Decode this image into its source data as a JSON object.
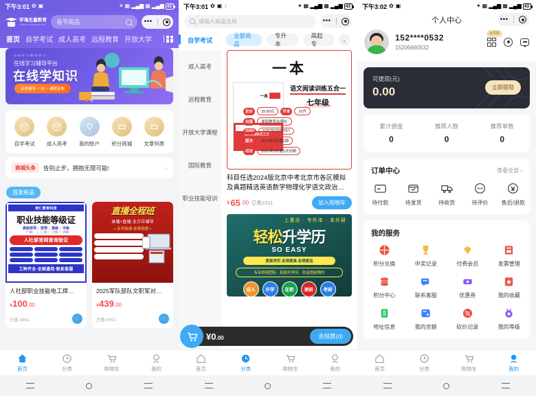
{
  "phone1": {
    "status": {
      "time": "下午3:01",
      "battery": "43"
    },
    "brand": {
      "name": "学海无量教育",
      "sub": "XUEHAI WULIANG EDU"
    },
    "search": {
      "placeholder": "春节商品",
      "icon": "search-icon"
    },
    "nav": [
      {
        "label": "首页",
        "active": true
      },
      {
        "label": "自学考试",
        "active": false
      },
      {
        "label": "成人高考",
        "active": false
      },
      {
        "label": "远程教育",
        "active": false
      },
      {
        "label": "开放大学",
        "active": false
      }
    ],
    "banner": {
      "eyebrow": "在/线/学/习/辅/导/学/习",
      "subtitle": "在线学习辅导平台",
      "title": "在线学知识",
      "pill": "名师辅导·一对一·课程定制",
      "dots": 2,
      "active_dot": 1
    },
    "quick": [
      {
        "label": "自学考试",
        "icon": "coin-gold-icon",
        "color": "#e8c887"
      },
      {
        "label": "成人高考",
        "icon": "coin-gold-icon",
        "color": "#e8c887"
      },
      {
        "label": "我的账户",
        "icon": "diamond-icon",
        "color": "#b9cfe8"
      },
      {
        "label": "积分商城",
        "icon": "crown-icon",
        "color": "#e8c887"
      },
      {
        "label": "文章列表",
        "icon": "crown-icon",
        "color": "#e8c887"
      }
    ],
    "notice": {
      "tag": "商城头条",
      "text": "告别止步，拥抱无限可能!",
      "arrow": "chevron-right-icon"
    },
    "new_tag": "首发新品",
    "products": [
      {
        "name": "人社部职业技能电工焊…",
        "price_symbol": "¥",
        "price_int": "100",
        "price_dec": ".00",
        "sold": "已售 8461",
        "poster": {
          "header": "培仁教育科技",
          "title": "职业技能等级证",
          "cols": [
            {
              "t": "高级技师",
              "s": "(一级)"
            },
            {
              "t": "技师",
              "s": "(二级)"
            },
            {
              "t": "高级",
              "s": "(三级)"
            },
            {
              "t": "中级",
              "s": "(四级)"
            }
          ],
          "redband": "人社部官网查询验证",
          "footer": "工种齐全·全国通用·联系客服"
        }
      },
      {
        "name": "2025军队部队文职军对…",
        "price_symbol": "¥",
        "price_int": "439",
        "price_dec": ".00",
        "sold": "已售 6451",
        "poster": {
          "title": "直播全程班",
          "sub1": "录播+直播·全方位辅导",
          "sub2": "⇢ 名师授课·逐章梳理 ⇠",
          "bars": 4
        }
      }
    ],
    "tabbar": [
      {
        "label": "首页",
        "icon": "home-icon",
        "active": true
      },
      {
        "label": "分类",
        "icon": "category-icon",
        "active": false
      },
      {
        "label": "购物车",
        "icon": "cart-icon",
        "active": false
      },
      {
        "label": "我的",
        "icon": "user-icon",
        "active": false
      }
    ]
  },
  "phone2": {
    "status": {
      "time": "下午3:01",
      "battery": "43"
    },
    "search": {
      "placeholder": "请输入商品名称",
      "icon": "search-icon"
    },
    "active_category": "自学考试",
    "filters": [
      {
        "label": "全部商品",
        "active": true
      },
      {
        "label": "专升本",
        "active": false
      },
      {
        "label": "高起专",
        "active": false
      }
    ],
    "filter_expand_icon": "chevron-down-icon",
    "sidebar": [
      {
        "label": "成人高考"
      },
      {
        "label": "远程教育"
      },
      {
        "label": "开放大学课程"
      },
      {
        "label": "国际教育"
      },
      {
        "label": "职业技能培训"
      }
    ],
    "book": {
      "brand": "一本",
      "series": "语文阅读训练五合一",
      "grade": "七年级",
      "cover_title": "语文阅读训练五合一",
      "specs": [
        {
          "k": "定价",
          "v": "39.80元"
        },
        {
          "k": "开本",
          "v": "16开"
        },
        {
          "k": "出版",
          "v": "湖南教育出版社"
        },
        {
          "k": "ISBN",
          "v": "9787553967257"
        },
        {
          "k": "版次",
          "v": "2019年4月第1版"
        },
        {
          "k": "印次",
          "v": "2021年3月第3次印刷"
        }
      ],
      "title": "科目任选2024版北京中考北京市各区模拟及真题精选英语数学物理化学语文政治…",
      "price_symbol": "¥",
      "price_int": "65",
      "price_dec": ".00",
      "sold": "已售2311",
      "add_button": "加入购物车"
    },
    "ad": {
      "top": "上重点 · 专升本 · 本升研",
      "title_a": "轻松",
      "title_b": "升学历",
      "soeasy": "SO EASY",
      "band1": "更高学历 走得更高 走得更远",
      "band2": "专业师资团队 · 轻松升学历 · 欢迎提前预约",
      "pills": [
        {
          "label": "成人",
          "color": "#f0932b"
        },
        {
          "label": "升学",
          "color": "#2b7de9"
        },
        {
          "label": "在职",
          "color": "#16a34a"
        },
        {
          "label": "读研",
          "color": "#dc2626"
        },
        {
          "label": "考研",
          "color": "#2b7de9"
        }
      ]
    },
    "cartbar": {
      "icon": "cart-icon",
      "symbol": "¥",
      "amount_int": "0",
      "amount_dec": ".00",
      "checkout": "去结算(0)"
    },
    "tabbar": [
      {
        "label": "首页",
        "icon": "home-icon",
        "active": false
      },
      {
        "label": "分类",
        "icon": "category-icon",
        "active": true
      },
      {
        "label": "购物车",
        "icon": "cart-icon",
        "active": false
      },
      {
        "label": "我的",
        "icon": "user-icon",
        "active": false
      }
    ]
  },
  "phone3": {
    "status": {
      "time": "下午3:02",
      "battery": "43"
    },
    "title": "个人中心",
    "user": {
      "masked_phone": "152****0532",
      "phone": "15206660532",
      "avatar": "avatar"
    },
    "vip_badge": "会员码",
    "header_icons": [
      {
        "name": "qr-code-icon"
      },
      {
        "name": "settings-icon"
      },
      {
        "name": "message-icon"
      }
    ],
    "wallet": {
      "label": "可提现(元)",
      "value": "0.00",
      "button": "立即提现"
    },
    "stats": [
      {
        "k": "累计佣金",
        "v": "0"
      },
      {
        "k": "推荐人数",
        "v": "0"
      },
      {
        "k": "推荐单数",
        "v": "0"
      }
    ],
    "orders": {
      "title": "订单中心",
      "view_all": "查看全部 ›",
      "items": [
        {
          "label": "待付款",
          "icon": "card-icon"
        },
        {
          "label": "待发货",
          "icon": "box-check-icon"
        },
        {
          "label": "待收货",
          "icon": "truck-icon"
        },
        {
          "label": "待评价",
          "icon": "comment-icon"
        },
        {
          "label": "售后/退款",
          "icon": "refund-icon"
        }
      ]
    },
    "services": {
      "title": "我的服务",
      "items": [
        {
          "label": "积分兑换",
          "icon": "gift-ball-icon",
          "color": "#e8574a"
        },
        {
          "label": "中奖记录",
          "icon": "trophy-icon",
          "color": "#f5b942"
        },
        {
          "label": "付费会员",
          "icon": "diamond-icon",
          "color": "#f5b942"
        },
        {
          "label": "发票管理",
          "icon": "invoice-icon",
          "color": "#e8574a"
        },
        {
          "label": "积分中心",
          "icon": "coins-icon",
          "color": "#e8574a"
        },
        {
          "label": "联系客服",
          "icon": "chat-icon",
          "color": "#3b82f6"
        },
        {
          "label": "优惠券",
          "icon": "coupon-icon",
          "color": "#8b5cf6"
        },
        {
          "label": "我的收藏",
          "icon": "star-icon",
          "color": "#e8574a"
        },
        {
          "label": "地址信息",
          "icon": "address-icon",
          "color": "#22c55e"
        },
        {
          "label": "我的余额",
          "icon": "wallet-icon",
          "color": "#3b82f6"
        },
        {
          "label": "砍价记录",
          "icon": "discount-icon",
          "color": "#e8574a"
        },
        {
          "label": "我的等级",
          "icon": "medal-icon",
          "color": "#8b5cf6"
        }
      ]
    },
    "tabbar": [
      {
        "label": "首页",
        "icon": "home-icon",
        "active": false
      },
      {
        "label": "分类",
        "icon": "category-icon",
        "active": false
      },
      {
        "label": "购物车",
        "icon": "cart-icon",
        "active": false
      },
      {
        "label": "我的",
        "icon": "user-icon",
        "active": true
      }
    ]
  }
}
